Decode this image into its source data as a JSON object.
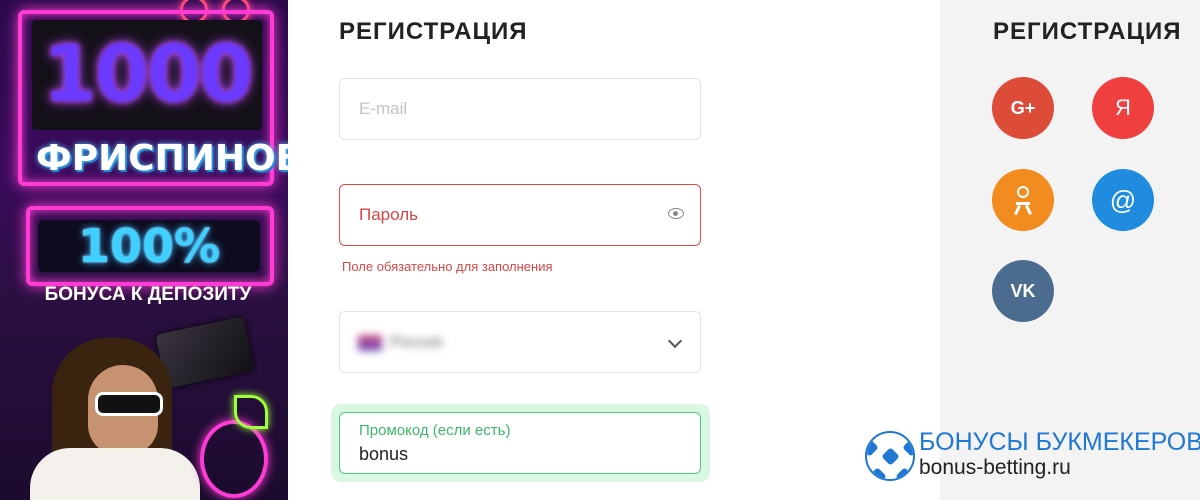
{
  "banner": {
    "freespins_count": "1000",
    "freespins_label": "ФРИСПИНОВ",
    "bonus_percent": "100%",
    "bonus_label": "БОНУСА К ДЕПОЗИТУ"
  },
  "form": {
    "title": "РЕГИСТРАЦИЯ",
    "email_placeholder": "E-mail",
    "password_placeholder": "Пароль",
    "password_error": "Поле обязательно для заполнения",
    "country_value": "Россия",
    "promo_label": "Промокод (если есть)",
    "promo_value": "bonus"
  },
  "social": {
    "title": "РЕГИСТРАЦИЯ",
    "google_label": "G+",
    "yandex_label": "Я",
    "mailru_label": "@",
    "vk_label": "VK",
    "colors": {
      "google": "#dd4b39",
      "yandex": "#ef3f3f",
      "odnoklassniki": "#f28c1f",
      "mailru": "#1f8ce0",
      "vk": "#4c6c8f"
    },
    "icons": [
      "google-plus-icon",
      "yandex-icon",
      "odnoklassniki-icon",
      "mailru-icon",
      "vk-icon"
    ]
  },
  "watermark": {
    "title": "БОНУСЫ БУКМЕКЕРОВ",
    "url": "bonus-betting.ru"
  },
  "colors": {
    "error": "#d94545",
    "promo_accent": "#3cb86a"
  }
}
